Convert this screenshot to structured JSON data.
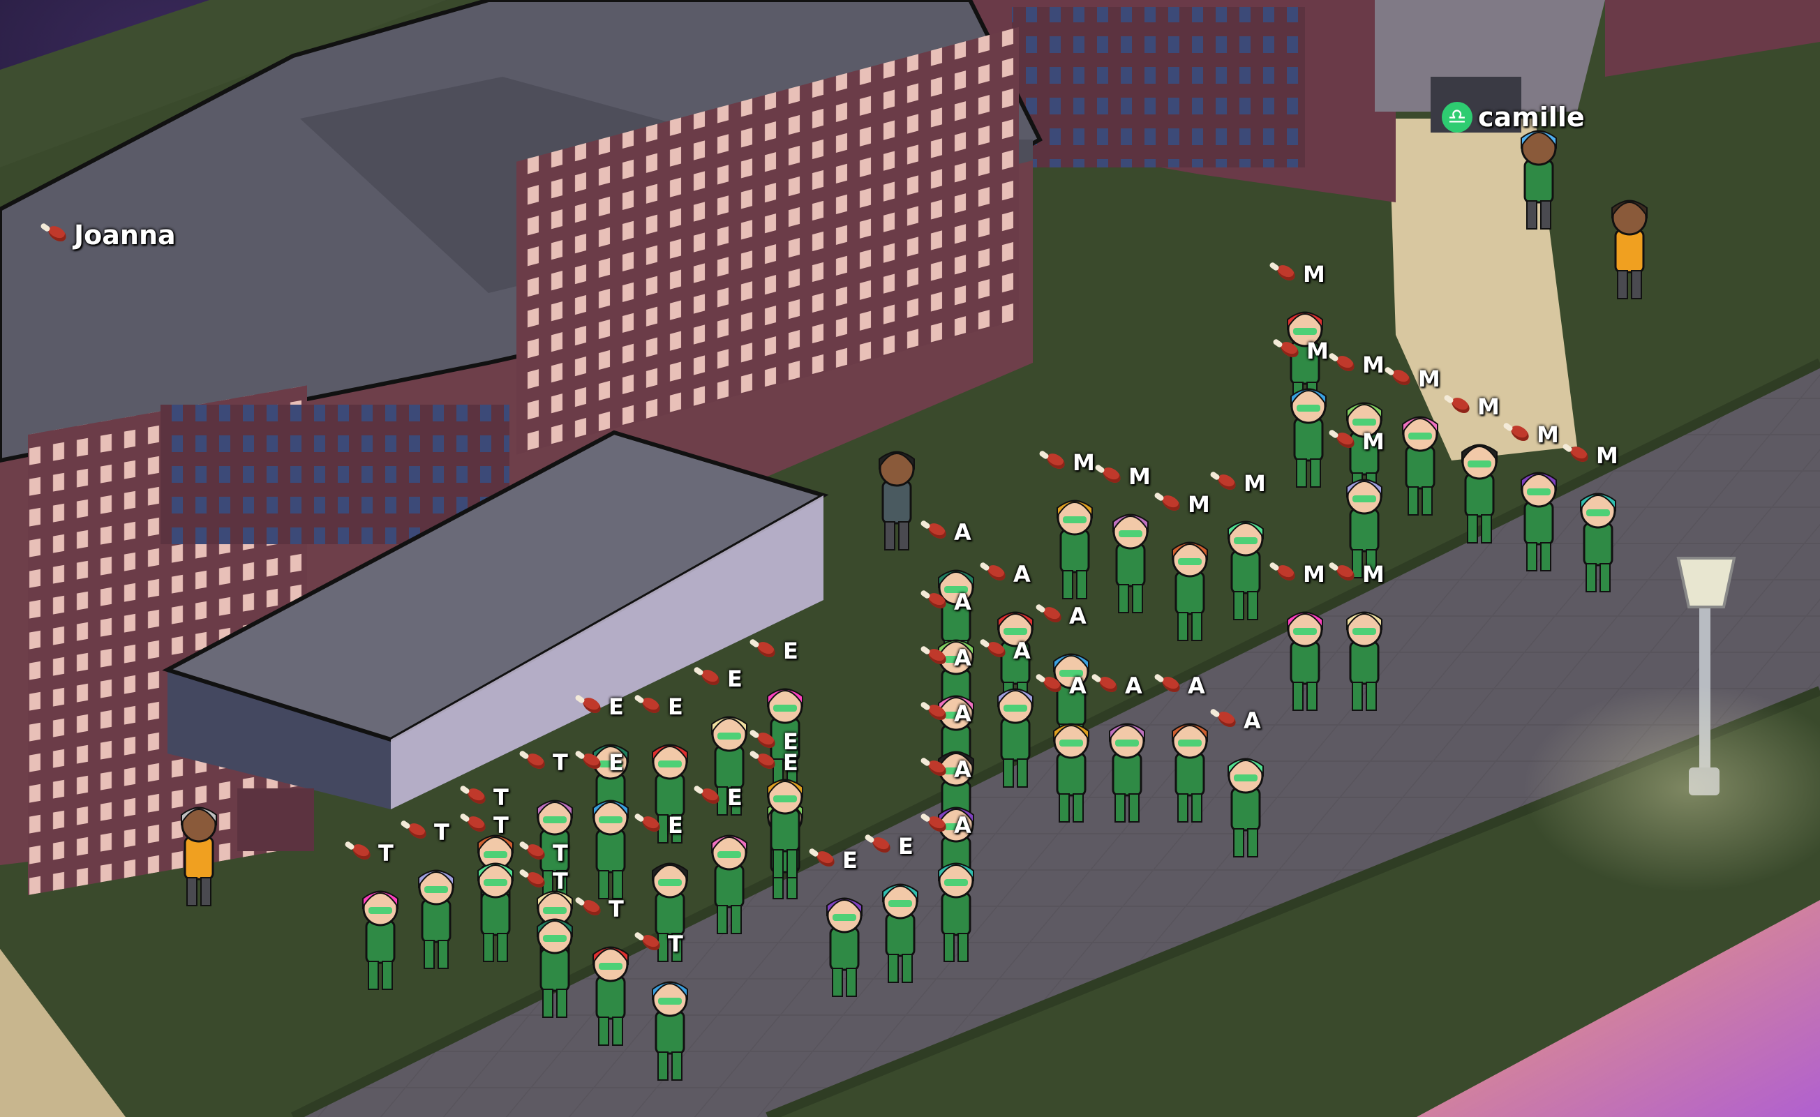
{
  "players": [
    {
      "name": "Joanna",
      "badge_icon": "meat-icon"
    },
    {
      "name": "camille",
      "badge_icon": "libra-zodiac-icon"
    }
  ],
  "team_letters": {
    "top_group": "M",
    "middle_group": "A",
    "front_group": "E",
    "left_group": "T"
  },
  "colors": {
    "grass": "#3a4a2c",
    "path": "#55515a",
    "building_wall": "#6e3f4a",
    "roof": "#5a5a66",
    "uniform": "#2f8a45",
    "sky_tile": "#e8895a"
  }
}
